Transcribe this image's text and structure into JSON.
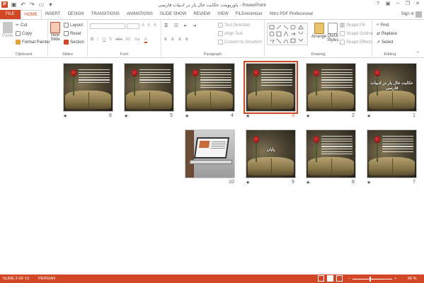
{
  "window": {
    "title": "پاورپوینت حکایت خال یار در ادبیات فارسی - PowerPoint",
    "help_label": "?",
    "minimize_label": "─",
    "restore_label": "❐",
    "close_label": "✕"
  },
  "qat": {
    "logo_label": "P"
  },
  "tabs": [
    "FILE",
    "HOME",
    "INSERT",
    "DESIGN",
    "TRANSITIONS",
    "ANIMATIONS",
    "SLIDE SHOW",
    "REVIEW",
    "VIEW",
    "FILEminimizer",
    "Nitro PDF Professional"
  ],
  "active_tab": "HOME",
  "signin_label": "Sign in",
  "ribbon": {
    "clipboard": {
      "paste": "Paste",
      "cut": "Cut",
      "copy": "Copy",
      "format_painter": "Format Painter",
      "label": "Clipboard"
    },
    "slides": {
      "new_slide": "New",
      "new_slide_2": "Slide",
      "layout": "Layout",
      "reset": "Reset",
      "section": "Section",
      "label": "Slides"
    },
    "font": {
      "bold": "B",
      "italic": "I",
      "underline": "U",
      "shadow": "S",
      "strike": "abc",
      "spacing": "AV",
      "case": "Aa",
      "color": "A",
      "grow": "A",
      "shrink": "A",
      "clear": "A",
      "label": "Font"
    },
    "paragraph": {
      "text_direction": "Text Direction",
      "align_text": "Align Text",
      "convert_smartart": "Convert to SmartArt",
      "label": "Paragraph"
    },
    "drawing": {
      "arrange": "Arrange",
      "quick_styles": "Quick",
      "quick_styles_2": "Styles",
      "shape_fill": "Shape Fill",
      "shape_outline": "Shape Outline",
      "shape_effects": "Shape Effects",
      "label": "Drawing"
    },
    "editing": {
      "find": "Find",
      "replace": "Replace",
      "select": "Select",
      "label": "Editing"
    }
  },
  "slides": [
    {
      "number": "1",
      "title": "حکایت خال یار در ادبیات فارسی",
      "kind": "title",
      "star": "★",
      "selected": false
    },
    {
      "number": "2",
      "title": "",
      "kind": "text",
      "star": "★",
      "selected": false
    },
    {
      "number": "3",
      "title": "",
      "kind": "text",
      "star": "★",
      "selected": true
    },
    {
      "number": "4",
      "title": "",
      "kind": "text",
      "star": "★",
      "selected": false
    },
    {
      "number": "5",
      "title": "",
      "kind": "text",
      "star": "★",
      "selected": false
    },
    {
      "number": "6",
      "title": "",
      "kind": "text",
      "star": "★",
      "selected": false
    },
    {
      "number": "7",
      "title": "",
      "kind": "text",
      "star": "★",
      "selected": false
    },
    {
      "number": "8",
      "title": "",
      "kind": "text",
      "star": "★",
      "selected": false
    },
    {
      "number": "9",
      "title": "پایان",
      "kind": "title",
      "star": "★",
      "selected": false
    },
    {
      "number": "10",
      "title": "",
      "kind": "laptop",
      "star": "",
      "selected": false
    }
  ],
  "status": {
    "slide_info": "SLIDE 3 OF 10",
    "language": "PERSIAN",
    "zoom_level": 66,
    "zoom_text": "66 %",
    "zoom_minus": "–",
    "zoom_plus": "+"
  },
  "colors": {
    "accent": "#d24726",
    "ribbon_bg": "#ffffff"
  }
}
